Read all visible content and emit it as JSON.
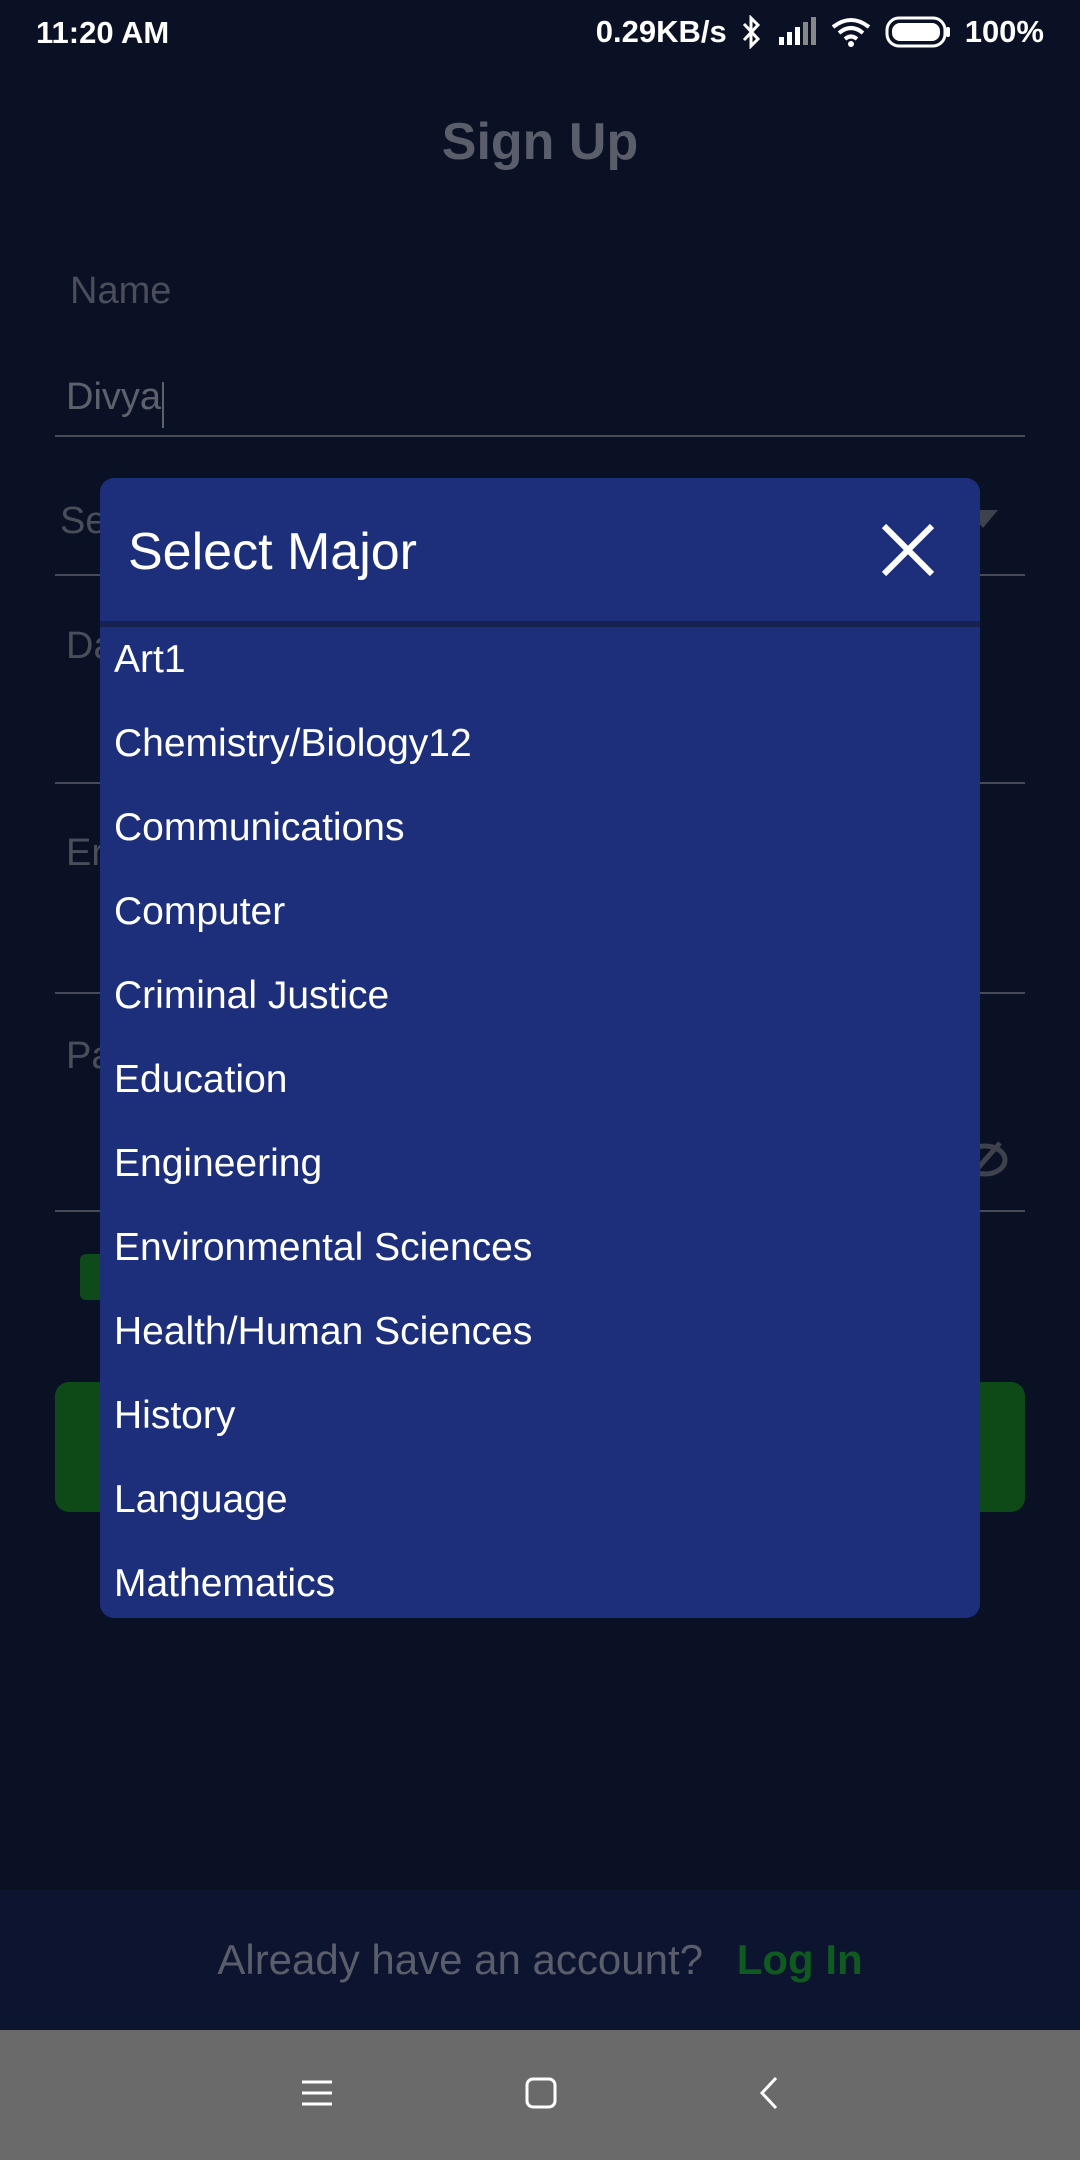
{
  "status_bar": {
    "time": "11:20 AM",
    "speed": "0.29KB/s",
    "battery": "100%"
  },
  "form": {
    "title": "Sign Up",
    "name_label": "Name",
    "name_value": "Divya",
    "select_label_partial": "Se",
    "date_label_partial": "Da",
    "email_label_partial": "Er",
    "password_label_partial": "Pa"
  },
  "modal": {
    "title": "Select Major",
    "items": [
      "Art1",
      "Chemistry/Biology12",
      "Communications",
      "Computer",
      "Criminal Justice",
      "Education",
      "Engineering",
      "Environmental Sciences",
      "Health/Human Sciences",
      "History",
      "Language",
      "Mathematics"
    ]
  },
  "footer": {
    "question": "Already have an account?",
    "login": "Log In"
  }
}
